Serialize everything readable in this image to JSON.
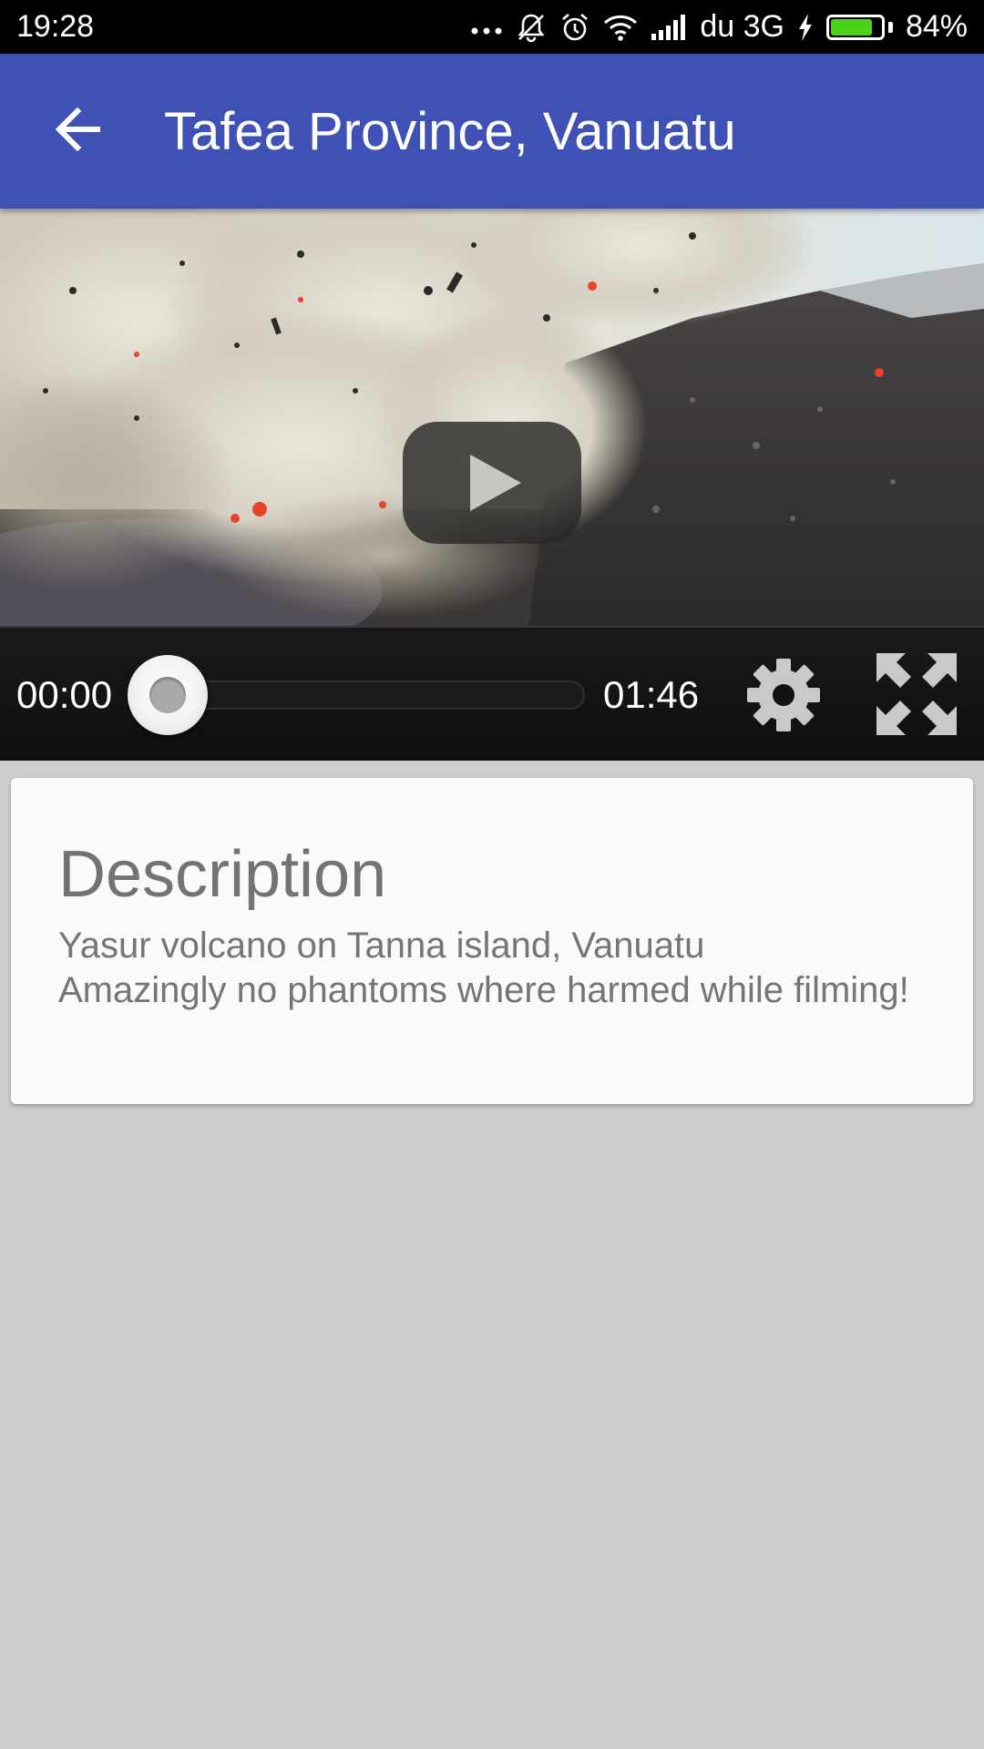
{
  "status_bar": {
    "time": "19:28",
    "network_label": "du 3G",
    "battery_percent_text": "84%",
    "battery_level": 0.84,
    "icons": [
      "overflow-dots-icon",
      "muted-bell-icon",
      "alarm-icon",
      "wifi-icon",
      "cell-signal-icon",
      "charging-bolt-icon",
      "battery-icon"
    ],
    "battery_color": "#4cd21a"
  },
  "app_bar": {
    "title": "Tafea Province, Vanuatu",
    "back_icon": "arrow-left-icon",
    "color": "#3f51b5"
  },
  "video": {
    "current_time": "00:00",
    "total_time": "01:46",
    "progress": 0.0,
    "play_icon": "play-icon",
    "settings_icon": "gear-icon",
    "fullscreen_icon": "fullscreen-expand-icon"
  },
  "description": {
    "heading": "Description",
    "body": "Yasur volcano on Tanna island, Vanuatu\nAmazingly no phantoms where harmed while filming!"
  }
}
